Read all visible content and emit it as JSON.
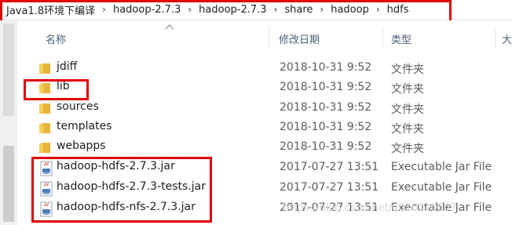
{
  "breadcrumb": [
    "Java1.8环境下编译",
    "hadoop-2.7.3",
    "hadoop-2.7.3",
    "share",
    "hadoop",
    "hdfs"
  ],
  "breadcrumb_separator": "›",
  "columns": {
    "name": "名称",
    "date": "修改日期",
    "type": "类型",
    "size": "大"
  },
  "rows": [
    {
      "name": "jdiff",
      "date": "2018-10-31 9:52",
      "type": "文件夹",
      "icon": "folder-icon"
    },
    {
      "name": "lib",
      "date": "2018-10-31 9:52",
      "type": "文件夹",
      "icon": "folder-icon"
    },
    {
      "name": "sources",
      "date": "2018-10-31 9:52",
      "type": "文件夹",
      "icon": "folder-icon"
    },
    {
      "name": "templates",
      "date": "2018-10-31 9:52",
      "type": "文件夹",
      "icon": "folder-icon"
    },
    {
      "name": "webapps",
      "date": "2018-10-31 9:52",
      "type": "文件夹",
      "icon": "folder-icon"
    },
    {
      "name": "hadoop-hdfs-2.7.3.jar",
      "date": "2017-07-27 13:51",
      "type": "Executable Jar File",
      "icon": "jar-icon"
    },
    {
      "name": "hadoop-hdfs-2.7.3-tests.jar",
      "date": "2017-07-27 13:51",
      "type": "Executable Jar File",
      "icon": "jar-icon"
    },
    {
      "name": "hadoop-hdfs-nfs-2.7.3.jar",
      "date": "2017-07-27 13:51",
      "type": "Executable Jar File",
      "icon": "jar-icon"
    }
  ],
  "watermark": "https://blog.csdn.net/u010010607",
  "highlight_color": "#e00000"
}
